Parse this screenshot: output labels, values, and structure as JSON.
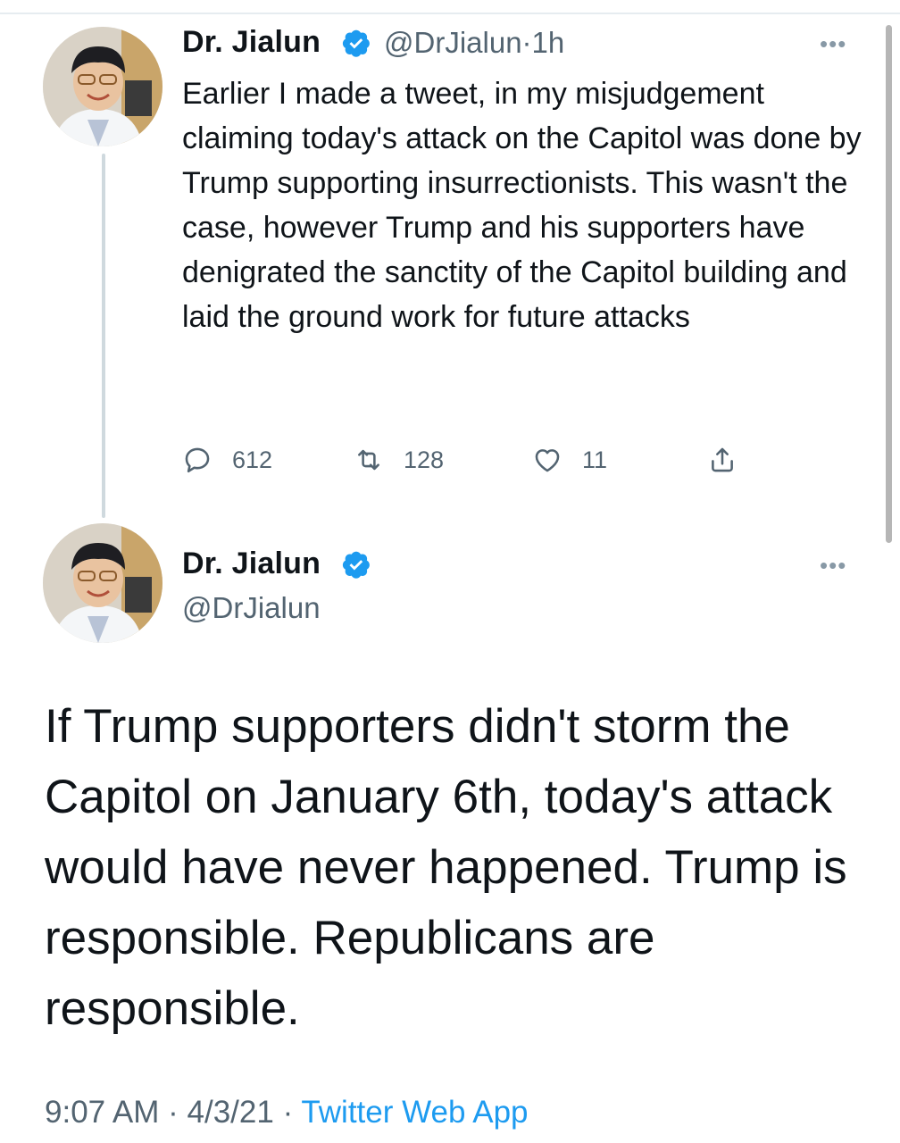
{
  "tweet1": {
    "author_name": "Dr. Jialun",
    "handle": "@DrJialun",
    "time_sep": "·",
    "time": "1h",
    "text": "Earlier I made a tweet, in my misjudgement claiming today's attack on the Capitol was done by Trump supporting insurrectionists. This wasn't the case, however Trump and his supporters have denigrated the sanctity of the Capitol building and laid the ground work for future attacks",
    "replies": "612",
    "retweets": "128",
    "likes": "11",
    "more_label": "•••"
  },
  "tweet2": {
    "author_name": "Dr. Jialun",
    "handle": "@DrJialun",
    "text": "If Trump supporters didn't storm the Capitol on January 6th, today's attack would have never happened. Trump is responsible. Republicans are responsible.",
    "time": "9:07 AM",
    "sep1": " · ",
    "date": "4/3/21",
    "sep2": " · ",
    "source": "Twitter Web App",
    "more_label": "•••"
  },
  "icons": {
    "verified": "verified-badge-icon",
    "reply": "reply-icon",
    "retweet": "retweet-icon",
    "like": "heart-icon",
    "share": "share-icon",
    "more": "more-icon"
  },
  "colors": {
    "text": "#0f1419",
    "secondary": "#536471",
    "accent": "#1d9bf0"
  }
}
